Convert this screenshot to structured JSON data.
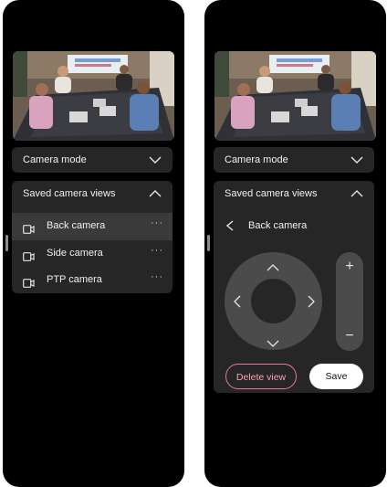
{
  "left_panel": {
    "camera_mode": {
      "label": "Camera mode",
      "icon": "chevron-down-icon"
    },
    "saved_views": {
      "label": "Saved camera views",
      "icon": "chevron-up-icon",
      "items": [
        {
          "label": "Back camera",
          "more": "···",
          "selected": true
        },
        {
          "label": "Side camera",
          "more": "···",
          "selected": false
        },
        {
          "label": "PTP camera",
          "more": "···",
          "selected": false
        }
      ]
    }
  },
  "right_panel": {
    "camera_mode": {
      "label": "Camera mode",
      "icon": "chevron-down-icon"
    },
    "saved_views": {
      "label": "Saved camera views",
      "icon": "chevron-up-icon",
      "edit": {
        "back_icon": "chevron-left-icon",
        "title": "Back camera",
        "zoom_in": "+",
        "zoom_out": "−",
        "delete_label": "Delete view",
        "save_label": "Save"
      }
    }
  },
  "colors": {
    "panel_bg": "#000000",
    "card_bg": "#262626",
    "selected_bg": "#3a3a3a",
    "control_bg": "#4b4b4b",
    "delete_accent": "#e87a90"
  }
}
